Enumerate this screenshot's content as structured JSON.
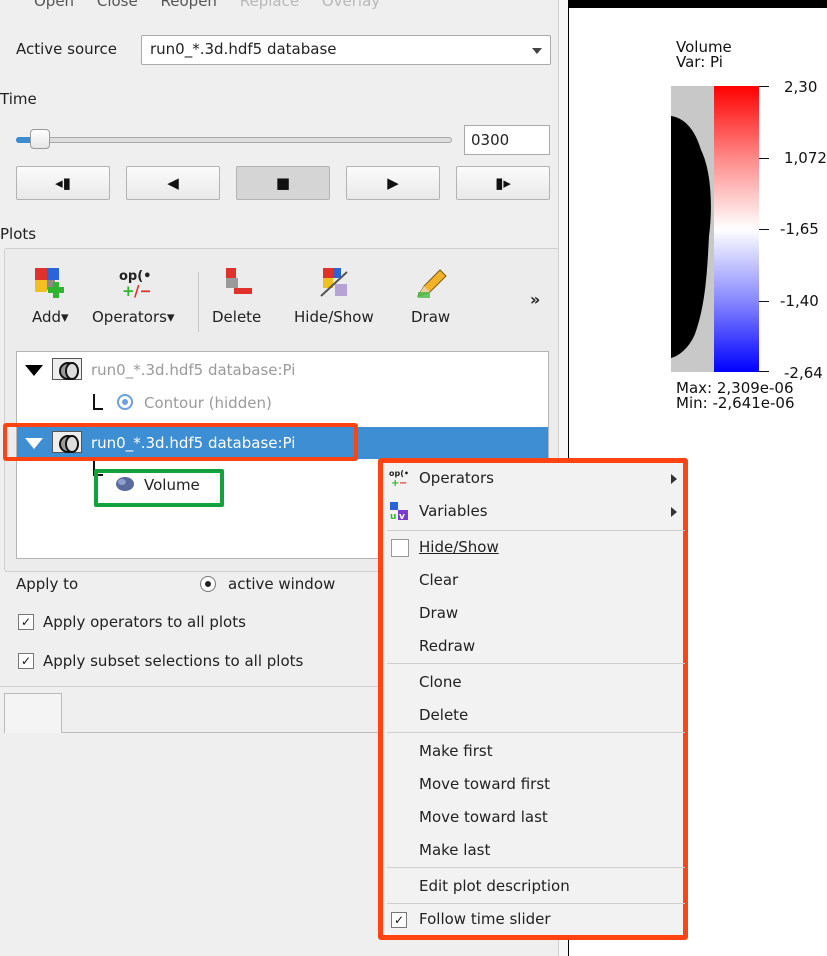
{
  "menu": {
    "items": [
      "Open",
      "Close",
      "Reopen",
      "Replace",
      "Overlay"
    ]
  },
  "source": {
    "label": "Active source",
    "value": "run0_*.3d.hdf5 database"
  },
  "time": {
    "label": "Time",
    "frame": "0300"
  },
  "plots": {
    "label": "Plots",
    "toolbar": {
      "add": "Add",
      "operators": "Operators",
      "delete": "Delete",
      "hide_show": "Hide/Show",
      "draw": "Draw",
      "more": "»"
    },
    "list": [
      {
        "label": "run0_*.3d.hdf5 database:Pi"
      },
      {
        "label": "Contour (hidden)"
      },
      {
        "label": "run0_*.3d.hdf5 database:Pi"
      },
      {
        "label": "Volume"
      }
    ]
  },
  "apply": {
    "label": "Apply to",
    "radio_label": "active window",
    "operators_all": "Apply operators to all plots",
    "subset_all": "Apply subset selections to all plots"
  },
  "legend": {
    "title": "Volume",
    "var": "Var: Pi",
    "ticks": [
      "2,30",
      "1,072",
      "-1,65",
      "-1,40",
      "-2,64"
    ],
    "max": "Max:  2,309e-06",
    "min": "Min: -2,641e-06"
  },
  "context_menu": {
    "operators": "Operators",
    "variables": "Variables",
    "hide_show": "Hide/Show",
    "clear": "Clear",
    "draw": "Draw",
    "redraw": "Redraw",
    "clone": "Clone",
    "delete": "Delete",
    "make_first": "Make first",
    "move_first": "Move toward first",
    "move_last": "Move toward last",
    "make_last": "Make last",
    "edit_desc": "Edit plot description",
    "follow_time": "Follow time slider"
  },
  "colors": {
    "selection": "#3d8ed3",
    "highlight_red": "#ff4411",
    "highlight_green": "#11a23c"
  }
}
